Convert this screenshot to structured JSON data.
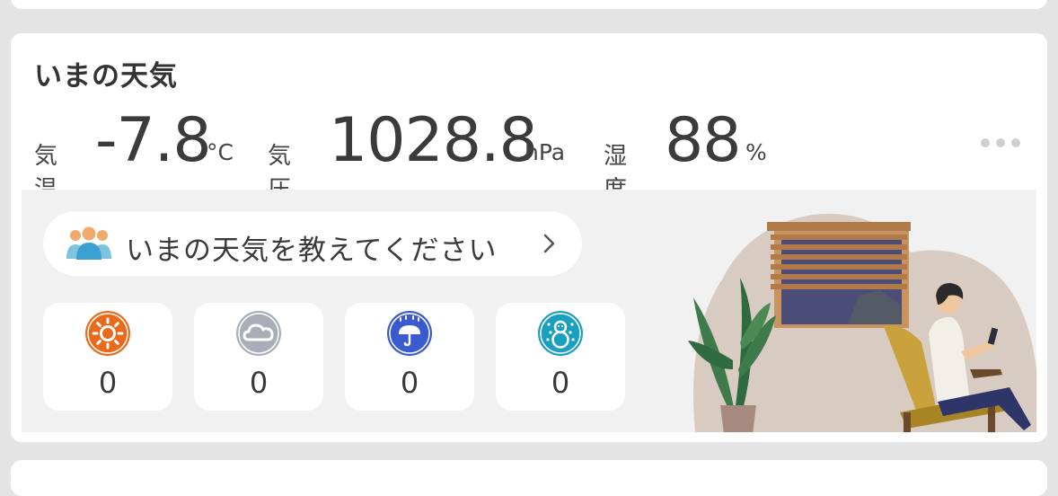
{
  "card": {
    "title": "いまの天気"
  },
  "stats": {
    "temperature": {
      "label": "気温",
      "value": "-7.8",
      "unit": "°C"
    },
    "pressure": {
      "label": "気圧",
      "value": "1028.8",
      "unit": "hPa"
    },
    "humidity": {
      "label": "湿度",
      "value": "88",
      "unit": "%"
    }
  },
  "report": {
    "label": "いまの天気を教えてください",
    "icon": "people-icon",
    "chevron": "chevron-right-icon"
  },
  "weather_buttons": [
    {
      "icon": "sunny-icon",
      "count": "0",
      "color": "#ea6a1b"
    },
    {
      "icon": "cloudy-icon",
      "count": "0",
      "color": "#a8adb8"
    },
    {
      "icon": "rain-umbrella-icon",
      "count": "0",
      "color": "#3a5bd0"
    },
    {
      "icon": "snowman-icon",
      "count": "0",
      "color": "#1a9fc0"
    }
  ],
  "colors": {
    "sunny": "#ea6a1b",
    "cloudy": "#a8adb8",
    "rain": "#3a5bd0",
    "snow": "#1a9fc0",
    "more_dots": "#cfcfcf"
  }
}
